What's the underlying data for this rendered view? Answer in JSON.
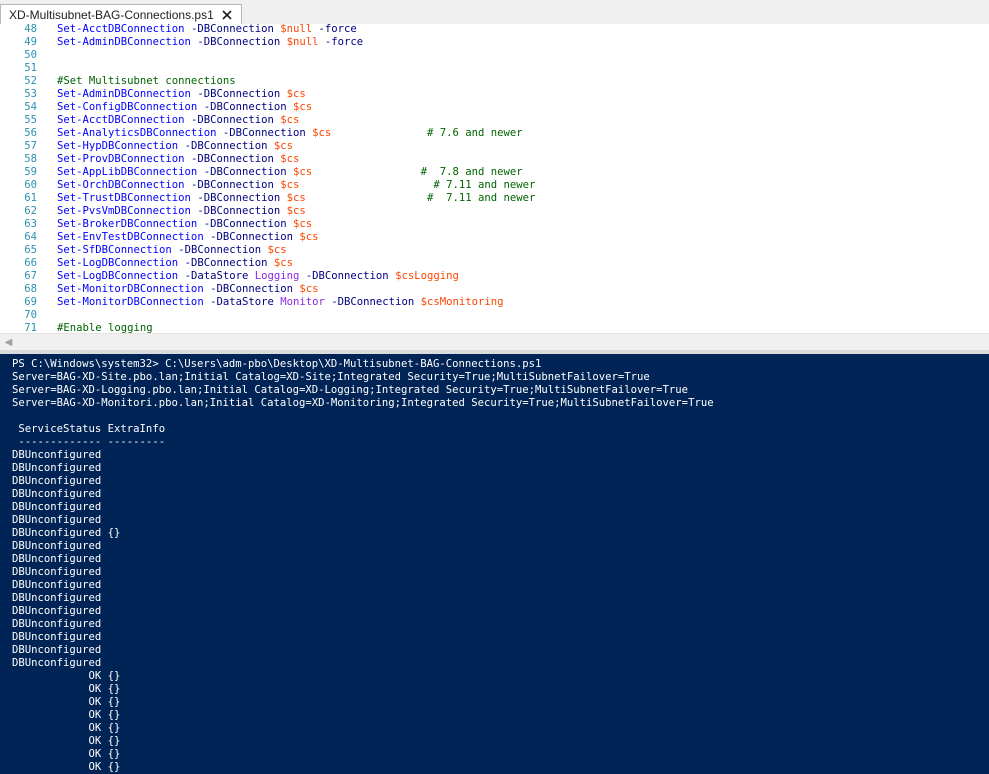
{
  "tab": {
    "title": "XD-Multisubnet-BAG-Connections.ps1",
    "close_icon": "close-icon"
  },
  "editor": {
    "lines": [
      {
        "num": "48",
        "parts": [
          [
            "cmd",
            "Set-AcctDBConnection"
          ],
          [
            "param",
            " -DBConnection "
          ],
          [
            "var",
            "$null"
          ],
          [
            "param",
            " -force"
          ]
        ]
      },
      {
        "num": "49",
        "parts": [
          [
            "cmd",
            "Set-AdminDBConnection"
          ],
          [
            "param",
            " -DBConnection "
          ],
          [
            "var",
            "$null"
          ],
          [
            "param",
            " -force"
          ]
        ]
      },
      {
        "num": "50",
        "parts": []
      },
      {
        "num": "51",
        "parts": []
      },
      {
        "num": "52",
        "parts": [
          [
            "cmt",
            "#Set Multisubnet connections"
          ]
        ]
      },
      {
        "num": "53",
        "parts": [
          [
            "cmd",
            "Set-AdminDBConnection"
          ],
          [
            "param",
            " -DBConnection "
          ],
          [
            "var",
            "$cs"
          ]
        ]
      },
      {
        "num": "54",
        "parts": [
          [
            "cmd",
            "Set-ConfigDBConnection"
          ],
          [
            "param",
            " -DBConnection "
          ],
          [
            "var",
            "$cs"
          ]
        ]
      },
      {
        "num": "55",
        "parts": [
          [
            "cmd",
            "Set-AcctDBConnection"
          ],
          [
            "param",
            " -DBConnection "
          ],
          [
            "var",
            "$cs"
          ]
        ]
      },
      {
        "num": "56",
        "parts": [
          [
            "cmd",
            "Set-AnalyticsDBConnection"
          ],
          [
            "param",
            " -DBConnection "
          ],
          [
            "var",
            "$cs"
          ],
          [
            "param",
            "               "
          ],
          [
            "cmt",
            "# 7.6 and newer"
          ]
        ]
      },
      {
        "num": "57",
        "parts": [
          [
            "cmd",
            "Set-HypDBConnection"
          ],
          [
            "param",
            " -DBConnection "
          ],
          [
            "var",
            "$cs"
          ]
        ]
      },
      {
        "num": "58",
        "parts": [
          [
            "cmd",
            "Set-ProvDBConnection"
          ],
          [
            "param",
            " -DBConnection "
          ],
          [
            "var",
            "$cs"
          ]
        ]
      },
      {
        "num": "59",
        "parts": [
          [
            "cmd",
            "Set-AppLibDBConnection"
          ],
          [
            "param",
            " -DBConnection "
          ],
          [
            "var",
            "$cs"
          ],
          [
            "param",
            "                 "
          ],
          [
            "cmt",
            "#  7.8 and newer"
          ]
        ]
      },
      {
        "num": "60",
        "parts": [
          [
            "cmd",
            "Set-OrchDBConnection"
          ],
          [
            "param",
            " -DBConnection "
          ],
          [
            "var",
            "$cs"
          ],
          [
            "param",
            "                     "
          ],
          [
            "cmt",
            "# 7.11 and newer"
          ]
        ]
      },
      {
        "num": "61",
        "parts": [
          [
            "cmd",
            "Set-TrustDBConnection"
          ],
          [
            "param",
            " -DBConnection "
          ],
          [
            "var",
            "$cs"
          ],
          [
            "param",
            "                   "
          ],
          [
            "cmt",
            "#  7.11 and newer"
          ]
        ]
      },
      {
        "num": "62",
        "parts": [
          [
            "cmd",
            "Set-PvsVmDBConnection"
          ],
          [
            "param",
            " -DBConnection "
          ],
          [
            "var",
            "$cs"
          ]
        ]
      },
      {
        "num": "63",
        "parts": [
          [
            "cmd",
            "Set-BrokerDBConnection"
          ],
          [
            "param",
            " -DBConnection "
          ],
          [
            "var",
            "$cs"
          ]
        ]
      },
      {
        "num": "64",
        "parts": [
          [
            "cmd",
            "Set-EnvTestDBConnection"
          ],
          [
            "param",
            " -DBConnection "
          ],
          [
            "var",
            "$cs"
          ]
        ]
      },
      {
        "num": "65",
        "parts": [
          [
            "cmd",
            "Set-SfDBConnection"
          ],
          [
            "param",
            " -DBConnection "
          ],
          [
            "var",
            "$cs"
          ]
        ]
      },
      {
        "num": "66",
        "parts": [
          [
            "cmd",
            "Set-LogDBConnection"
          ],
          [
            "param",
            " -DBConnection "
          ],
          [
            "var",
            "$cs"
          ]
        ]
      },
      {
        "num": "67",
        "parts": [
          [
            "cmd",
            "Set-LogDBConnection"
          ],
          [
            "param",
            " -DataStore "
          ],
          [
            "str",
            "Logging"
          ],
          [
            "param",
            " -DBConnection "
          ],
          [
            "var",
            "$csLogging"
          ]
        ]
      },
      {
        "num": "68",
        "parts": [
          [
            "cmd",
            "Set-MonitorDBConnection"
          ],
          [
            "param",
            " -DBConnection "
          ],
          [
            "var",
            "$cs"
          ]
        ]
      },
      {
        "num": "69",
        "parts": [
          [
            "cmd",
            "Set-MonitorDBConnection"
          ],
          [
            "param",
            " -DataStore "
          ],
          [
            "str",
            "Monitor"
          ],
          [
            "param",
            " -DBConnection "
          ],
          [
            "var",
            "$csMonitoring"
          ]
        ]
      },
      {
        "num": "70",
        "parts": []
      },
      {
        "num": "71",
        "parts": [
          [
            "cmt",
            "#Enable logging"
          ]
        ]
      }
    ]
  },
  "console": {
    "lines": [
      "PS C:\\Windows\\system32> C:\\Users\\adm-pbo\\Desktop\\XD-Multisubnet-BAG-Connections.ps1",
      "Server=BAG-XD-Site.pbo.lan;Initial Catalog=XD-Site;Integrated Security=True;MultiSubnetFailover=True",
      "Server=BAG-XD-Logging.pbo.lan;Initial Catalog=XD-Logging;Integrated Security=True;MultiSubnetFailover=True",
      "Server=BAG-XD-Monitori.pbo.lan;Initial Catalog=XD-Monitoring;Integrated Security=True;MultiSubnetFailover=True",
      "",
      " ServiceStatus ExtraInfo",
      " ------------- ---------",
      "DBUnconfigured",
      "DBUnconfigured",
      "DBUnconfigured",
      "DBUnconfigured",
      "DBUnconfigured",
      "DBUnconfigured",
      "DBUnconfigured {}",
      "DBUnconfigured",
      "DBUnconfigured",
      "DBUnconfigured",
      "DBUnconfigured",
      "DBUnconfigured",
      "DBUnconfigured",
      "DBUnconfigured",
      "DBUnconfigured",
      "DBUnconfigured",
      "DBUnconfigured",
      "            OK {}",
      "            OK {}",
      "            OK {}",
      "            OK {}",
      "            OK {}",
      "            OK {}",
      "            OK {}",
      "            OK {}",
      "            OK {}"
    ]
  }
}
